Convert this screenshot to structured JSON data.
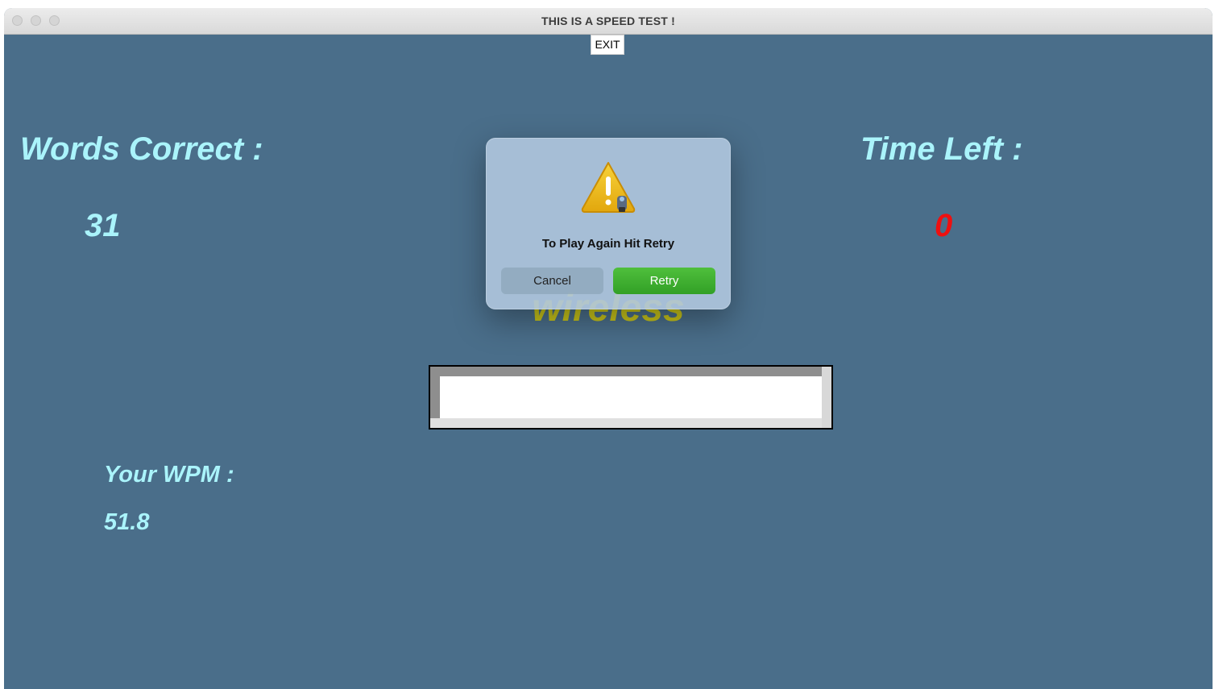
{
  "window": {
    "title": "THIS IS A SPEED TEST !"
  },
  "toolbar": {
    "exit_label": "EXIT"
  },
  "stats": {
    "words_correct_label": "Words Correct :",
    "words_correct_value": "31",
    "time_left_label": "Time Left :",
    "time_left_value": "0",
    "wpm_label": "Your WPM :",
    "wpm_value": "51.8"
  },
  "game": {
    "current_word": "wireless",
    "input_value": ""
  },
  "dialog": {
    "message": "To Play Again Hit Retry",
    "cancel_label": "Cancel",
    "retry_label": "Retry",
    "icon": "warning-icon"
  },
  "colors": {
    "background": "#4a6e8a",
    "label_text": "#aaf4fb",
    "time_value": "#ee1010",
    "word_text": "#c8c41a",
    "retry_button": "#3aab2d"
  }
}
